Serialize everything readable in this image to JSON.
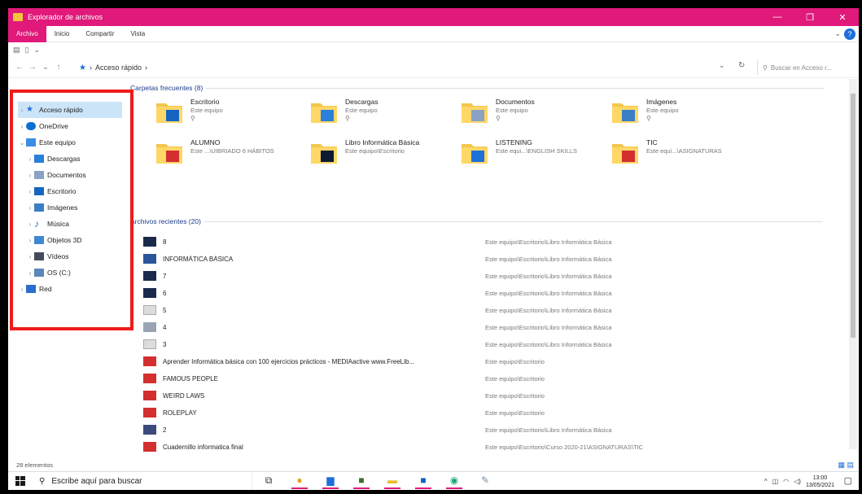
{
  "window": {
    "title": "Explorador de archivos",
    "controls": {
      "minimize": "—",
      "maximize": "❐",
      "close": "✕"
    }
  },
  "menu": {
    "items": [
      "Archivo",
      "Inicio",
      "Compartir",
      "Vista"
    ],
    "active": "Archivo"
  },
  "address": {
    "path": "Acceso rápido",
    "search_placeholder": "Buscar en Acceso r..."
  },
  "nav": {
    "items": [
      {
        "label": "Acceso rápido",
        "icon": "star-icon",
        "color": "#1e6fd9",
        "level": 0,
        "exp": "›"
      },
      {
        "label": "OneDrive",
        "icon": "cloud-icon",
        "color": "#0a6fd1",
        "level": 0,
        "exp": "›"
      },
      {
        "label": "Este equipo",
        "icon": "computer-icon",
        "color": "#3a8ee6",
        "level": 0,
        "exp": "⌄"
      },
      {
        "label": "Descargas",
        "icon": "download-icon",
        "color": "#2a7fd8",
        "level": 1,
        "exp": "›"
      },
      {
        "label": "Documentos",
        "icon": "document-icon",
        "color": "#8aa3c4",
        "level": 1,
        "exp": "›"
      },
      {
        "label": "Escritorio",
        "icon": "desktop-icon",
        "color": "#1565c0",
        "level": 1,
        "exp": "›"
      },
      {
        "label": "Imágenes",
        "icon": "image-icon",
        "color": "#3a7ec6",
        "level": 1,
        "exp": "›"
      },
      {
        "label": "Música",
        "icon": "music-icon",
        "color": "#1e6fd9",
        "level": 1,
        "exp": "›"
      },
      {
        "label": "Objetos 3D",
        "icon": "cube-icon",
        "color": "#3f87d6",
        "level": 1,
        "exp": "›"
      },
      {
        "label": "Vídeos",
        "icon": "video-icon",
        "color": "#444c5c",
        "level": 1,
        "exp": "›"
      },
      {
        "label": "OS (C:)",
        "icon": "drive-icon",
        "color": "#5a88b8",
        "level": 1,
        "exp": "›"
      },
      {
        "label": "Red",
        "icon": "network-icon",
        "color": "#2a6ecc",
        "level": 0,
        "exp": "›"
      }
    ]
  },
  "content": {
    "frequent_header": "Carpetas frecuentes (8)",
    "recent_header": "Archivos recientes (20)",
    "folders": [
      {
        "name": "Escritorio",
        "sub": "Este equipo",
        "pinned": true,
        "color": "#1565c0"
      },
      {
        "name": "Descargas",
        "sub": "Este equipo",
        "pinned": true,
        "color": "#2a7fd8"
      },
      {
        "name": "Documentos",
        "sub": "Este equipo",
        "pinned": true,
        "color": "#8aa3c4"
      },
      {
        "name": "Imágenes",
        "sub": "Este equipo",
        "pinned": true,
        "color": "#3a7ec6"
      },
      {
        "name": "ALUMNO",
        "sub": "Este ...\\UIBRIADO 6 HÁBITOS",
        "pinned": false,
        "color": "#d32f2f"
      },
      {
        "name": "Libro Informática Básica",
        "sub": "Este equipo\\Escritorio",
        "pinned": false,
        "color": "#0d1b33"
      },
      {
        "name": "LISTENING",
        "sub": "Este equi...\\ENGLISH SKILLS",
        "pinned": false,
        "color": "#1e6fd9"
      },
      {
        "name": "TIC",
        "sub": "Este equi...\\ASIGNATURAS",
        "pinned": false,
        "color": "#d32f2f"
      }
    ],
    "files": [
      {
        "name": "8",
        "path": "Este equipo\\Escritorio\\Libro Informática Básica",
        "color": "#1b2a4a"
      },
      {
        "name": "INFORMÁTICA BÁSICA",
        "path": "Este equipo\\Escritorio\\Libro Informática Básica",
        "color": "#2b579a"
      },
      {
        "name": "7",
        "path": "Este equipo\\Escritorio\\Libro Informática Básica",
        "color": "#1b2a4a"
      },
      {
        "name": "6",
        "path": "Este equipo\\Escritorio\\Libro Informática Básica",
        "color": "#1b2a4a"
      },
      {
        "name": "5",
        "path": "Este equipo\\Escritorio\\Libro Informática Básica",
        "color": "#dcdcdc"
      },
      {
        "name": "4",
        "path": "Este equipo\\Escritorio\\Libro Informática Básica",
        "color": "#9aa4b2"
      },
      {
        "name": "3",
        "path": "Este equipo\\Escritorio\\Libro Informática Básica",
        "color": "#dcdcdc"
      },
      {
        "name": "Aprender Informática básica con 100 ejercicios prácticos - MEDIAactive www.FreeLib...",
        "path": "Este equipo\\Escritorio",
        "color": "#d32f2f"
      },
      {
        "name": "FAMOUS PEOPLE",
        "path": "Este equipo\\Escritorio",
        "color": "#d32f2f"
      },
      {
        "name": "WEIRD LAWS",
        "path": "Este equipo\\Escritorio",
        "color": "#d32f2f"
      },
      {
        "name": "ROLEPLAY",
        "path": "Este equipo\\Escritorio",
        "color": "#d32f2f"
      },
      {
        "name": "2",
        "path": "Este equipo\\Escritorio\\Libro Informática Básica",
        "color": "#3a4a7a"
      },
      {
        "name": "Cuadernillo informatica final",
        "path": "Este equipo\\Escritorio\\Curso 2020-21\\ASIGNATURAS\\TIC",
        "color": "#d32f2f"
      }
    ]
  },
  "status": {
    "count": "28 elementos"
  },
  "taskbar": {
    "search_placeholder": "Escribe aquí para buscar",
    "apps": [
      {
        "icon": "task-view-icon",
        "glyph": "⧉",
        "color": "#333"
      },
      {
        "icon": "chrome-icon",
        "glyph": "●",
        "color": "#e3a21a"
      },
      {
        "icon": "file-explorer-icon",
        "glyph": "▆",
        "color": "#1e6fd9"
      },
      {
        "icon": "minecraft-icon",
        "glyph": "■",
        "color": "#3b6e2a"
      },
      {
        "icon": "folder-icon",
        "glyph": "▬",
        "color": "#e8b92e"
      },
      {
        "icon": "outlook-icon",
        "glyph": "■",
        "color": "#0a64b8"
      },
      {
        "icon": "edge-icon",
        "glyph": "◉",
        "color": "#1ea37a"
      },
      {
        "icon": "paint-icon",
        "glyph": "✎",
        "color": "#7a8fa6"
      }
    ],
    "time": "13:00",
    "date": "13/05/2021"
  },
  "colors": {
    "accent": "#e0197a",
    "highlight_box": "#f01b1b"
  }
}
